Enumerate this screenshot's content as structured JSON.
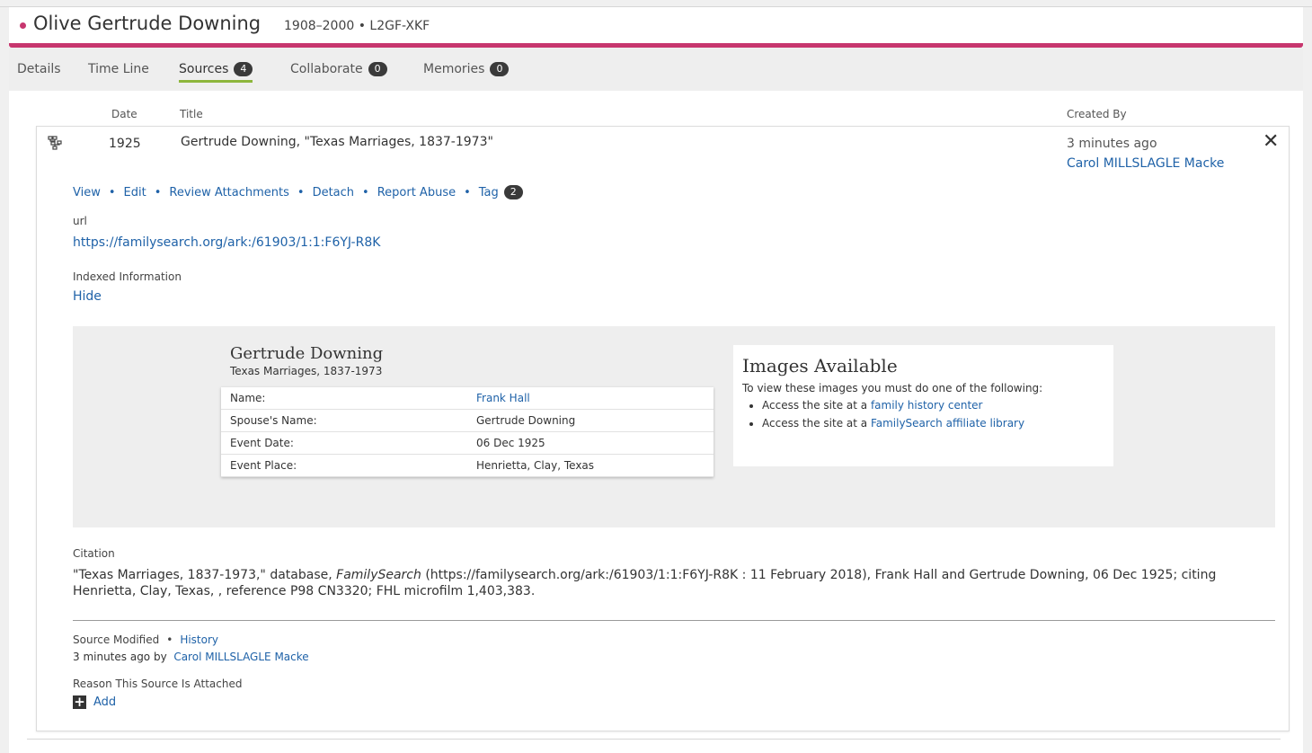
{
  "person": {
    "name": "Olive Gertrude Downing",
    "meta": "1908–2000 • L2GF-XKF"
  },
  "tabs": [
    {
      "label": "Details",
      "badge": ""
    },
    {
      "label": "Time Line",
      "badge": ""
    },
    {
      "label": "Sources",
      "badge": "4"
    },
    {
      "label": "Collaborate",
      "badge": "0"
    },
    {
      "label": "Memories",
      "badge": "0"
    }
  ],
  "columns": {
    "date": "Date",
    "title": "Title",
    "created_by": "Created By"
  },
  "source": {
    "date": "1925",
    "title": "Gertrude Downing, \"Texas Marriages, 1837-1973\"",
    "created_ago": "3 minutes ago",
    "created_by": "Carol MILLSLAGLE Macke",
    "icon": "family-tree-icon",
    "close_icon": "close-icon",
    "actions": [
      "View",
      "Edit",
      "Review Attachments",
      "Detach",
      "Report Abuse",
      "Tag"
    ],
    "tag_count": "2",
    "url_label": "url",
    "url": "https://familysearch.org/ark:/61903/1:1:F6YJ-R8K",
    "indexed_label": "Indexed Information",
    "hide_label": "Hide"
  },
  "record": {
    "name": "Gertrude Downing",
    "collection": "Texas Marriages, 1837-1973",
    "rows": [
      {
        "label": "Name:",
        "value": "Frank Hall"
      },
      {
        "label": "Spouse's Name:",
        "value": "Gertrude Downing"
      },
      {
        "label": "Event Date:",
        "value": "06 Dec 1925"
      },
      {
        "label": "Event Place:",
        "value": "Henrietta, Clay, Texas"
      }
    ]
  },
  "images": {
    "title": "Images Available",
    "description": "To view these images you must do one of the following:",
    "options": [
      {
        "prefix": "Access the site at a ",
        "link": "family history center"
      },
      {
        "prefix": "Access the site at a ",
        "link": "FamilySearch affiliate library"
      }
    ]
  },
  "citation": {
    "label": "Citation",
    "part1": "\"Texas Marriages, 1837-1973,\" database, ",
    "italic": "FamilySearch",
    "part2": " (https://familysearch.org/ark:/61903/1:1:F6YJ-R8K : 11 February 2018), Frank Hall and Gertrude Downing, 06 Dec 1925; citing Henrietta, Clay, Texas, , reference P98 CN3320; FHL microfilm 1,403,383."
  },
  "modified": {
    "label": "Source Modified",
    "history": "History",
    "ago": "3 minutes ago by",
    "by": "Carol MILLSLAGLE Macke"
  },
  "reason": {
    "label": "Reason This Source Is Attached",
    "add": "Add",
    "add_icon": "plus-icon"
  },
  "colors": {
    "accent": "#c7366e",
    "link": "#1f62a8",
    "active_tab": "#8db63c"
  }
}
